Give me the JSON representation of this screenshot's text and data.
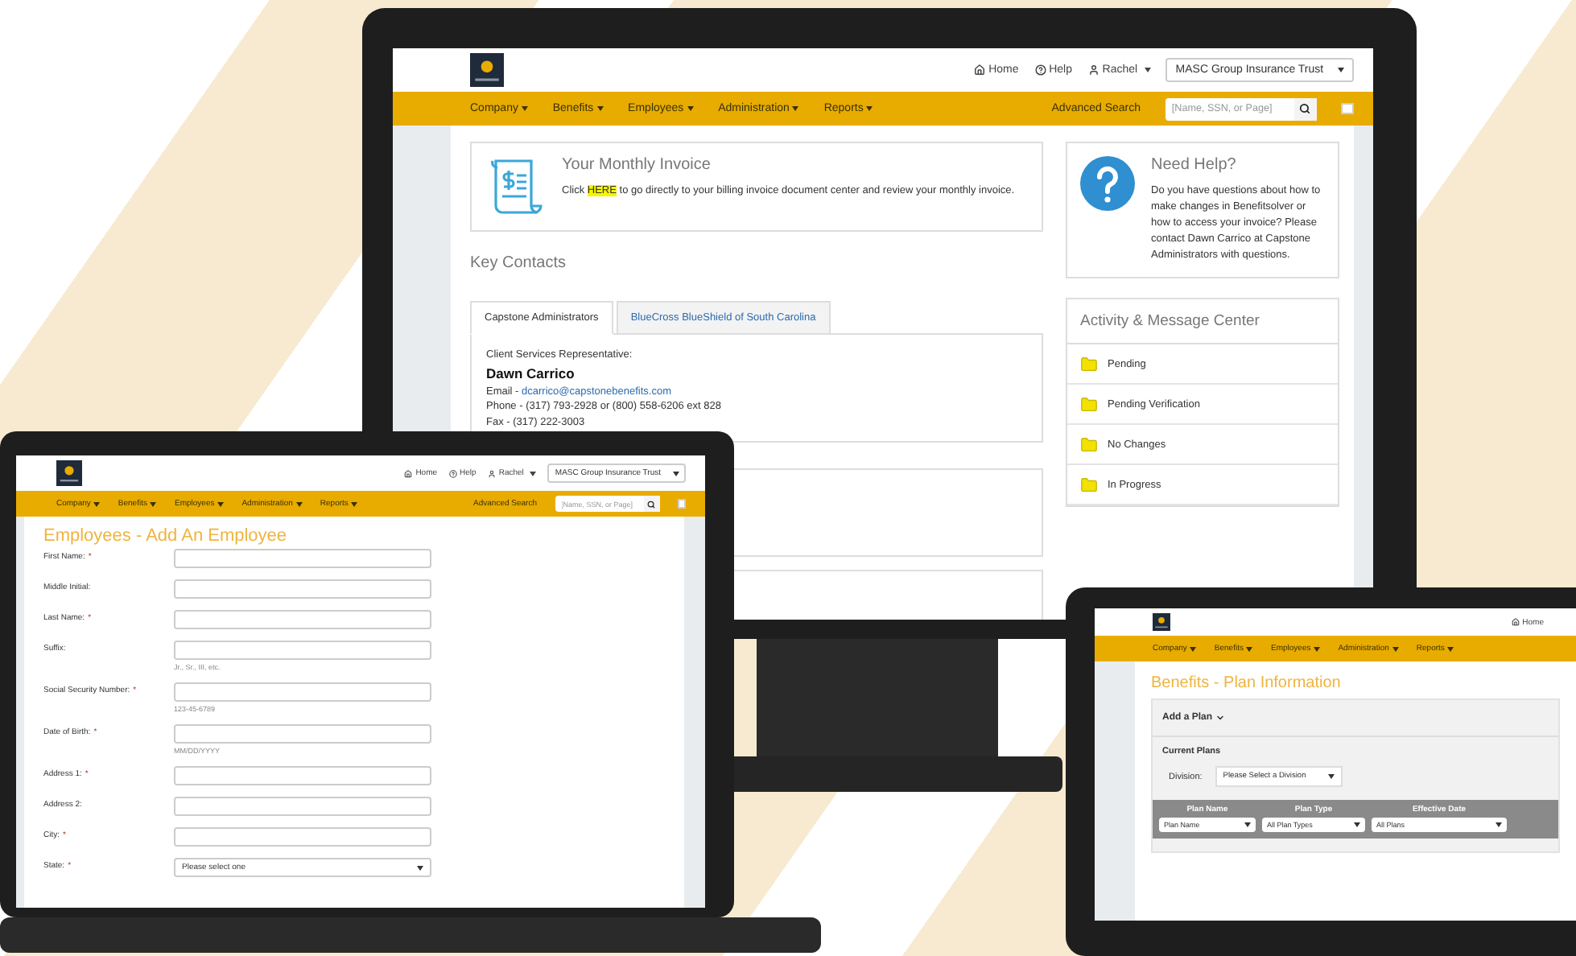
{
  "desktop": {
    "header": {
      "links": [
        {
          "kind": "home",
          "label": "Home"
        },
        {
          "kind": "help",
          "label": "Help"
        },
        {
          "kind": "user",
          "label": "Rachel"
        }
      ],
      "group_select": "MASC Group Insurance Trust"
    },
    "nav": {
      "menus": [
        "Company",
        "Benefits",
        "Employees",
        "Administration",
        "Reports"
      ],
      "advanced_search": "Advanced Search",
      "search": {
        "placeholder": "[Name, SSN, or Page]"
      },
      "checkbox": {
        "checked": false
      }
    },
    "invoice": {
      "title": "Your Monthly Invoice",
      "text_before": "Click ",
      "link": "HERE",
      "text_after": " to go directly to your billing invoice document center and review your monthly invoice."
    },
    "key_contacts": {
      "title": "Key Contacts",
      "tabs": [
        {
          "label": "Capstone Administrators",
          "selected": true
        },
        {
          "label": "BlueCross BlueShield of South Carolina",
          "selected": false
        }
      ],
      "contact": {
        "role": "Client Services Representative:",
        "name": "Dawn Carrico",
        "email_label": "Email - ",
        "email": "dcarrico@capstonebenefits.com",
        "phone": "Phone - (317) 793-2928 or (800) 558-6206 ext 828",
        "fax": "Fax - (317) 222-3003"
      }
    },
    "help": {
      "title": "Need Help?",
      "text": "Do you have questions about how to make changes in Benefitsolver or how to access your invoice?  Please contact Dawn Carrico at Capstone Administrators with questions."
    },
    "activity": {
      "title": "Activity & Message Center",
      "items": [
        {
          "label": "Pending"
        },
        {
          "label": "Pending Verification"
        },
        {
          "label": "No Changes"
        },
        {
          "label": "In Progress"
        }
      ]
    }
  },
  "laptop": {
    "header": {
      "links": [
        {
          "kind": "home",
          "label": "Home"
        },
        {
          "kind": "help",
          "label": "Help"
        },
        {
          "kind": "user",
          "label": "Rachel"
        }
      ],
      "group_select": "MASC Group Insurance Trust"
    },
    "nav": {
      "menus": [
        "Company",
        "Benefits",
        "Employees",
        "Administration",
        "Reports"
      ],
      "advanced_search": "Advanced Search",
      "search": {
        "placeholder": "[Name, SSN, or Page]"
      },
      "checkbox": {
        "checked": false
      }
    },
    "title": "Employees - Add An Employee",
    "fields": [
      {
        "kind": "text",
        "label": "First Name:",
        "required_mark": "*"
      },
      {
        "kind": "text",
        "label": "Middle Initial:"
      },
      {
        "kind": "text",
        "label": "Last Name:",
        "required_mark": "*"
      },
      {
        "kind": "text",
        "label": "Suffix:",
        "hint": "Jr., Sr., III, etc."
      },
      {
        "kind": "text",
        "label": "Social Security Number:",
        "required_mark": "*",
        "hint": "123-45-6789"
      },
      {
        "kind": "text",
        "label": "Date of Birth:",
        "required_mark": "*",
        "hint": "MM/DD/YYYY"
      },
      {
        "kind": "text",
        "label": "Address 1:",
        "required_mark": "*"
      },
      {
        "kind": "text",
        "label": "Address 2:"
      },
      {
        "kind": "text",
        "label": "City:",
        "required_mark": "*"
      },
      {
        "kind": "select",
        "label": "State:",
        "required_mark": "*",
        "value": "Please select one"
      }
    ]
  },
  "tablet": {
    "header": {
      "links": [
        {
          "kind": "home",
          "label": "Home"
        }
      ]
    },
    "nav": {
      "menus": [
        "Company",
        "Benefits",
        "Employees",
        "Administration",
        "Reports"
      ]
    },
    "title": "Benefits - Plan Information",
    "add_plan": "Add a Plan",
    "current_plans": "Current Plans",
    "division": {
      "label": "Division:",
      "value": "Please Select a Division"
    },
    "table": {
      "columns": [
        {
          "header": "Plan Name",
          "filter": "Plan Name"
        },
        {
          "header": "Plan Type",
          "filter": "All Plan Types"
        },
        {
          "header": "Effective Date",
          "filter": "All Plans"
        }
      ]
    }
  }
}
